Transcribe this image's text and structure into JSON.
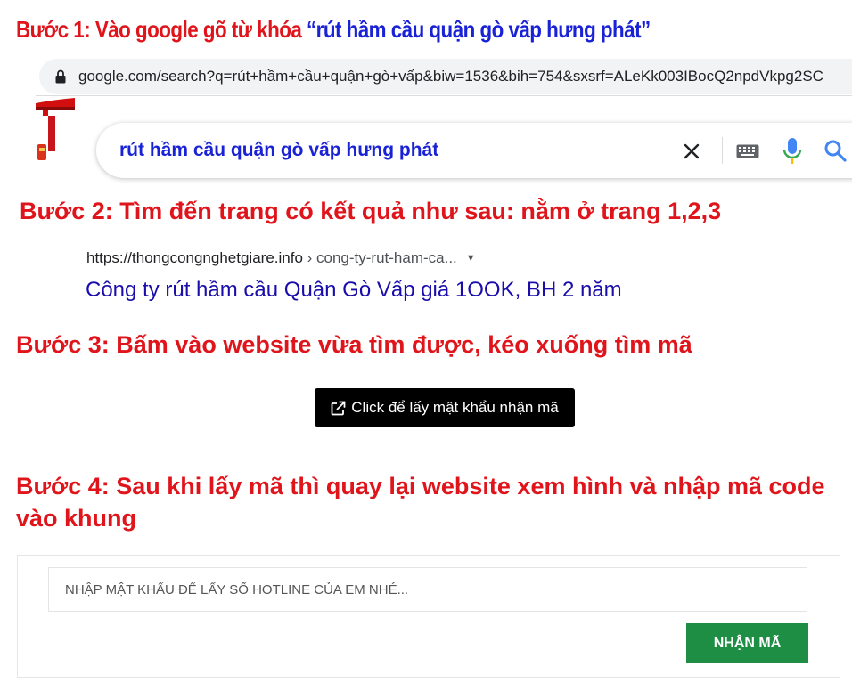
{
  "steps": {
    "step1_prefix": "Bước 1: Vào google gõ từ khóa ",
    "step1_keyword": "“rút hầm cầu quận gò vấp hưng phát”",
    "step2": "Bước 2: Tìm đến trang có kết quả như sau: nằm ở trang 1,2,3",
    "step3": "Bước 3: Bấm vào website vừa tìm được, kéo xuống tìm mã",
    "step4": "Bước 4: Sau khi lấy mã thì quay lại website xem hình và nhập mã code vào khung"
  },
  "browser": {
    "url": "google.com/search?q=rút+hầm+cầu+quận+gò+vấp&biw=1536&bih=754&sxsrf=ALeKk003IBocQ2npdVkpg2SC"
  },
  "search": {
    "query": "rút hầm cầu quận gò vấp hưng phát",
    "icons": [
      "close-icon",
      "keyboard-icon",
      "microphone-icon",
      "search-icon"
    ]
  },
  "result": {
    "site": "https://thongcongnghetgiare.info",
    "path": " › cong-ty-rut-ham-ca...",
    "caret": "▼",
    "title": "Công ty rút hầm cầu Quận Gò Vấp giá 1OOK, BH 2 năm"
  },
  "get_password_button": {
    "label": "Click để lấy mật khẩu nhận mã",
    "icon": "external-link-icon"
  },
  "form": {
    "placeholder": "NHẬP MẬT KHẨU ĐỂ LẤY SỐ HOTLINE CỦA EM NHÉ...",
    "value": "",
    "submit_label": "NHẬN MÃ"
  },
  "colors": {
    "instruction_red": "#e0141b",
    "keyword_blue": "#1a22d6",
    "result_title": "#1a0dab",
    "submit_green": "#1e8e44",
    "button_black": "#000000"
  }
}
